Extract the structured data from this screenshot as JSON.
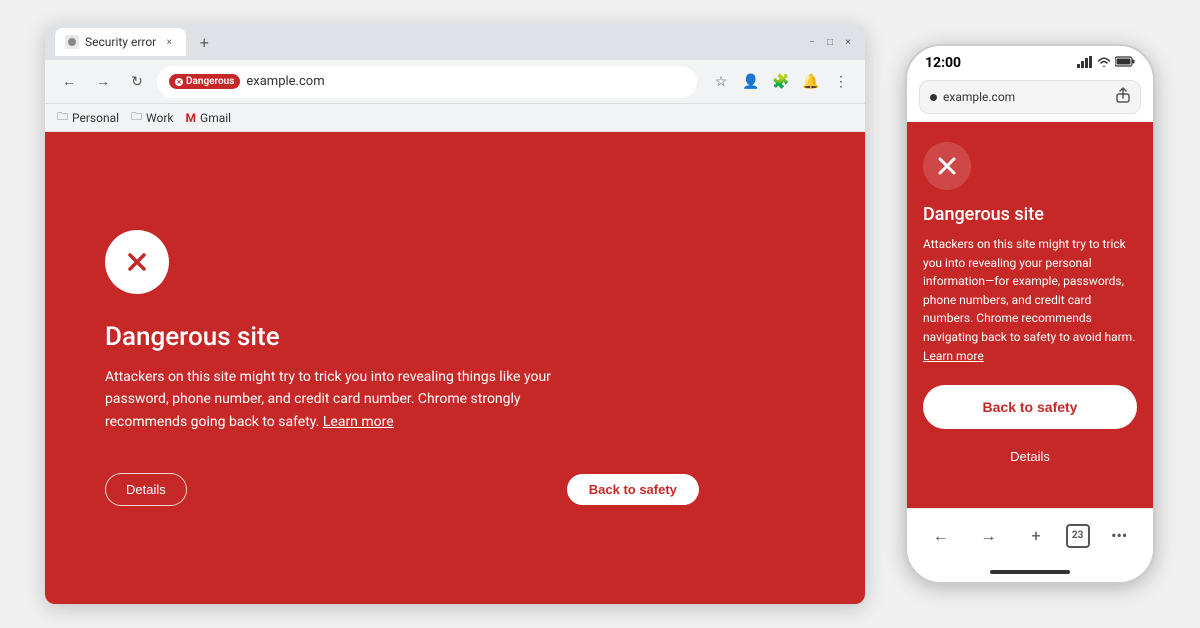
{
  "desktop": {
    "tab": {
      "title": "Security error",
      "close_label": "×",
      "new_tab_label": "+"
    },
    "window_controls": {
      "minimize": "−",
      "maximize": "□",
      "close": "×"
    },
    "toolbar": {
      "back": "←",
      "forward": "→",
      "reload": "↻",
      "dangerous_badge": "Dangerous",
      "address": "example.com"
    },
    "bookmarks": [
      {
        "icon": "🗀",
        "label": "Personal"
      },
      {
        "icon": "🗀",
        "label": "Work"
      },
      {
        "icon": "M",
        "label": "Gmail"
      }
    ],
    "content": {
      "title": "Dangerous site",
      "description": "Attackers on this site might try to trick you into revealing things like your password, phone number, and credit card number. Chrome strongly recommends going back to safety.",
      "learn_more": "Learn more",
      "btn_details": "Details",
      "btn_back_safety": "Back to safety"
    }
  },
  "mobile": {
    "status_bar": {
      "time": "12:00",
      "signal": "▋▋▋",
      "wifi": "WiFi",
      "battery": "🔋"
    },
    "address_bar": {
      "url": "example.com",
      "share_icon": "⬆"
    },
    "content": {
      "title": "Dangerous site",
      "description": "Attackers on this site might try to trick you into revealing your personal information—for example, passwords, phone numbers, and credit card numbers. Chrome recommends navigating back to safety to avoid harm.",
      "learn_more": "Learn more",
      "btn_back_safety": "Back to safety",
      "btn_details": "Details"
    },
    "nav": {
      "back": "←",
      "forward": "→",
      "new_tab": "+",
      "tab_count": "23",
      "menu": "•••"
    }
  }
}
